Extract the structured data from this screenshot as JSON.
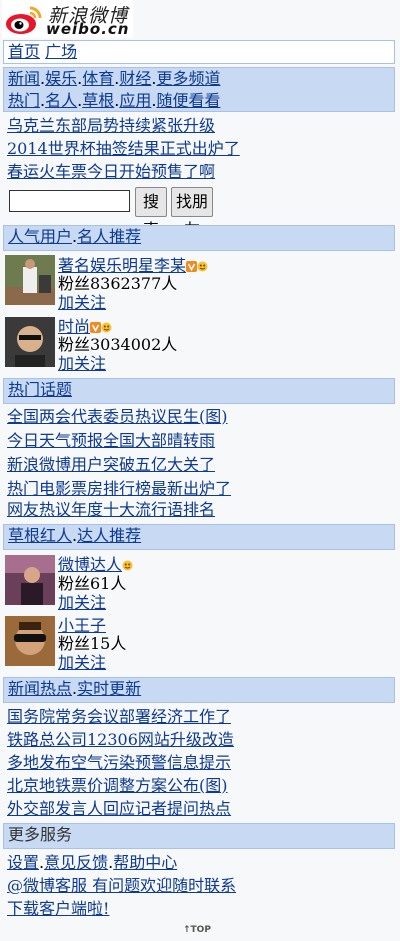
{
  "logo": {
    "cn_text": "新浪微博",
    "en_text": "weibo.cn"
  },
  "top_nav": {
    "items": [
      "首页",
      "广场"
    ]
  },
  "channels": {
    "row1": [
      "新闻",
      "娱乐",
      "体育",
      "财经",
      "更多频道"
    ],
    "row2": [
      "热门",
      "名人",
      "草根",
      "应用",
      "随便看看"
    ]
  },
  "headlines": [
    "乌克兰东部局势持续紧张升级",
    "2014世界杯抽签结果正式出炉了",
    "春运火车票今日开始预售了啊"
  ],
  "search": {
    "placeholder": "",
    "btn_search": "搜索",
    "btn_find": "找朋友"
  },
  "section_hot_people": {
    "title_a": "人气用户",
    "title_b": "名人推荐"
  },
  "hot_people": [
    {
      "name": "著名娱乐明星李某",
      "fans": "粉丝8362377人",
      "action": "加关注"
    },
    {
      "name": "时尚",
      "fans": "粉丝3034002人",
      "action": "加关注"
    }
  ],
  "section_topics": {
    "title": "热门话题"
  },
  "topics": [
    "全国两会代表委员热议民生(图)",
    "今日天气预报全国大部晴转雨",
    "新浪微博用户突破五亿大关了",
    "热门电影票房排行榜最新出炉了",
    "网友热议年度十大流行语排名"
  ],
  "section_grassroots": {
    "title_a": "草根红人",
    "title_b": "达人推荐"
  },
  "grassroots": [
    {
      "name": "微博达人",
      "fans": "粉丝61人",
      "action": "加关注"
    },
    {
      "name": "小王子",
      "fans": "粉丝15人",
      "action": "加关注"
    }
  ],
  "section_news": {
    "title_a": "新闻热点",
    "title_b": "实时更新"
  },
  "news": [
    "国务院常务会议部署经济工作了",
    "铁路总公司12306网站升级改造",
    "多地发布空气污染预警信息提示",
    "北京地铁票价调整方案公布(图)",
    "外交部发言人回应记者提问热点"
  ],
  "section_more": {
    "title": "更多服务"
  },
  "more": {
    "links": [
      "设置",
      "意见反馈",
      "帮助中心"
    ],
    "official": "@微博客服 有问题欢迎随时联系",
    "download": "下载客户端啦!"
  },
  "footer": {
    "top_label": "TOP"
  },
  "colors": {
    "accent_bar": "#c7d9f3",
    "link": "#0e3a91",
    "badge_orange": "#f28a1f"
  }
}
